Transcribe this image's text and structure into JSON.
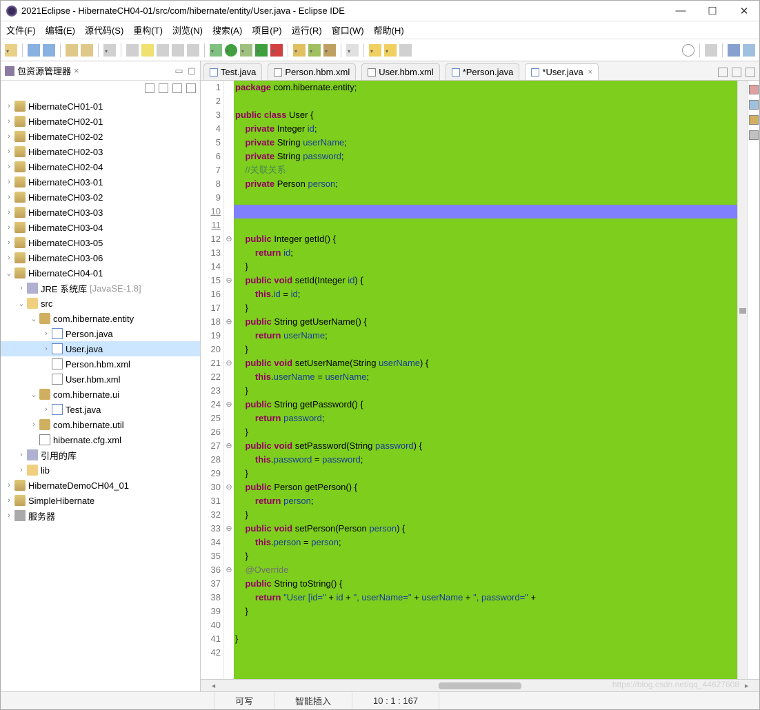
{
  "window": {
    "title": "2021Eclipse - HibernateCH04-01/src/com/hibernate/entity/User.java - Eclipse IDE"
  },
  "menu": [
    "文件(F)",
    "编辑(E)",
    "源代码(S)",
    "重构(T)",
    "浏览(N)",
    "搜索(A)",
    "项目(P)",
    "运行(R)",
    "窗口(W)",
    "帮助(H)"
  ],
  "explorer": {
    "title": "包资源管理器",
    "projects": [
      "HibernateCH01-01",
      "HibernateCH02-01",
      "HibernateCH02-02",
      "HibernateCH02-03",
      "HibernateCH02-04",
      "HibernateCH03-01",
      "HibernateCH03-02",
      "HibernateCH03-03",
      "HibernateCH03-04",
      "HibernateCH03-05",
      "HibernateCH03-06"
    ],
    "open_project": "HibernateCH04-01",
    "jre": "JRE 系统库",
    "jre_hint": "[JavaSE-1.8]",
    "src": "src",
    "pkg_entity": "com.hibernate.entity",
    "files_entity": [
      "Person.java",
      "User.java",
      "Person.hbm.xml",
      "User.hbm.xml"
    ],
    "pkg_ui": "com.hibernate.ui",
    "files_ui": [
      "Test.java"
    ],
    "pkg_util": "com.hibernate.util",
    "cfg": "hibernate.cfg.xml",
    "refs": "引用的库",
    "lib": "lib",
    "trailing": [
      "HibernateDemoCH04_01",
      "SimpleHibernate",
      "服务器"
    ]
  },
  "tabs": [
    {
      "label": "Test.java",
      "icon": "j"
    },
    {
      "label": "Person.hbm.xml",
      "icon": "x"
    },
    {
      "label": "User.hbm.xml",
      "icon": "x"
    },
    {
      "label": "*Person.java",
      "icon": "j"
    },
    {
      "label": "*User.java",
      "icon": "j",
      "active": true
    }
  ],
  "code": {
    "lines": [
      {
        "n": 1,
        "t": [
          [
            "kw",
            "package"
          ],
          [
            "type",
            " com.hibernate.entity;"
          ]
        ]
      },
      {
        "n": 2,
        "t": []
      },
      {
        "n": 3,
        "t": [
          [
            "kw",
            "public class"
          ],
          [
            "type",
            " User {"
          ]
        ]
      },
      {
        "n": 4,
        "t": [
          [
            "type",
            "    "
          ],
          [
            "kw",
            "private"
          ],
          [
            "type",
            " Integer "
          ],
          [
            "field",
            "id"
          ],
          [
            "type",
            ";"
          ]
        ]
      },
      {
        "n": 5,
        "t": [
          [
            "type",
            "    "
          ],
          [
            "kw",
            "private"
          ],
          [
            "type",
            " String "
          ],
          [
            "field",
            "userName"
          ],
          [
            "type",
            ";"
          ]
        ]
      },
      {
        "n": 6,
        "t": [
          [
            "type",
            "    "
          ],
          [
            "kw",
            "private"
          ],
          [
            "type",
            " String "
          ],
          [
            "field",
            "password"
          ],
          [
            "type",
            ";"
          ]
        ]
      },
      {
        "n": 7,
        "t": [
          [
            "type",
            "    "
          ],
          [
            "cmt",
            "//关联关系"
          ]
        ]
      },
      {
        "n": 8,
        "t": [
          [
            "type",
            "    "
          ],
          [
            "kw",
            "private"
          ],
          [
            "type",
            " Person "
          ],
          [
            "field",
            "person"
          ],
          [
            "type",
            ";"
          ]
        ]
      },
      {
        "n": 9,
        "t": []
      },
      {
        "n": 10,
        "t": [],
        "cursor": true
      },
      {
        "n": 11,
        "t": []
      },
      {
        "n": 12,
        "fold": "⊖",
        "t": [
          [
            "type",
            "    "
          ],
          [
            "kw",
            "public"
          ],
          [
            "type",
            " Integer getId() {"
          ]
        ]
      },
      {
        "n": 13,
        "t": [
          [
            "type",
            "        "
          ],
          [
            "kw",
            "return"
          ],
          [
            "type",
            " "
          ],
          [
            "field",
            "id"
          ],
          [
            "type",
            ";"
          ]
        ]
      },
      {
        "n": 14,
        "t": [
          [
            "type",
            "    }"
          ]
        ]
      },
      {
        "n": 15,
        "fold": "⊖",
        "t": [
          [
            "type",
            "    "
          ],
          [
            "kw",
            "public void"
          ],
          [
            "type",
            " setId(Integer "
          ],
          [
            "field",
            "id"
          ],
          [
            "type",
            ") {"
          ]
        ]
      },
      {
        "n": 16,
        "t": [
          [
            "type",
            "        "
          ],
          [
            "kw",
            "this"
          ],
          [
            "type",
            "."
          ],
          [
            "field",
            "id"
          ],
          [
            "type",
            " = "
          ],
          [
            "field",
            "id"
          ],
          [
            "type",
            ";"
          ]
        ]
      },
      {
        "n": 17,
        "t": [
          [
            "type",
            "    }"
          ]
        ]
      },
      {
        "n": 18,
        "fold": "⊖",
        "t": [
          [
            "type",
            "    "
          ],
          [
            "kw",
            "public"
          ],
          [
            "type",
            " String getUserName() {"
          ]
        ]
      },
      {
        "n": 19,
        "t": [
          [
            "type",
            "        "
          ],
          [
            "kw",
            "return"
          ],
          [
            "type",
            " "
          ],
          [
            "field",
            "userName"
          ],
          [
            "type",
            ";"
          ]
        ]
      },
      {
        "n": 20,
        "t": [
          [
            "type",
            "    }"
          ]
        ]
      },
      {
        "n": 21,
        "fold": "⊖",
        "t": [
          [
            "type",
            "    "
          ],
          [
            "kw",
            "public void"
          ],
          [
            "type",
            " setUserName(String "
          ],
          [
            "field",
            "userName"
          ],
          [
            "type",
            ") {"
          ]
        ]
      },
      {
        "n": 22,
        "t": [
          [
            "type",
            "        "
          ],
          [
            "kw",
            "this"
          ],
          [
            "type",
            "."
          ],
          [
            "field",
            "userName"
          ],
          [
            "type",
            " = "
          ],
          [
            "field",
            "userName"
          ],
          [
            "type",
            ";"
          ]
        ]
      },
      {
        "n": 23,
        "t": [
          [
            "type",
            "    }"
          ]
        ]
      },
      {
        "n": 24,
        "fold": "⊖",
        "t": [
          [
            "type",
            "    "
          ],
          [
            "kw",
            "public"
          ],
          [
            "type",
            " String getPassword() {"
          ]
        ]
      },
      {
        "n": 25,
        "t": [
          [
            "type",
            "        "
          ],
          [
            "kw",
            "return"
          ],
          [
            "type",
            " "
          ],
          [
            "field",
            "password"
          ],
          [
            "type",
            ";"
          ]
        ]
      },
      {
        "n": 26,
        "t": [
          [
            "type",
            "    }"
          ]
        ]
      },
      {
        "n": 27,
        "fold": "⊖",
        "t": [
          [
            "type",
            "    "
          ],
          [
            "kw",
            "public void"
          ],
          [
            "type",
            " setPassword(String "
          ],
          [
            "field",
            "password"
          ],
          [
            "type",
            ") {"
          ]
        ]
      },
      {
        "n": 28,
        "t": [
          [
            "type",
            "        "
          ],
          [
            "kw",
            "this"
          ],
          [
            "type",
            "."
          ],
          [
            "field",
            "password"
          ],
          [
            "type",
            " = "
          ],
          [
            "field",
            "password"
          ],
          [
            "type",
            ";"
          ]
        ]
      },
      {
        "n": 29,
        "t": [
          [
            "type",
            "    }"
          ]
        ]
      },
      {
        "n": 30,
        "fold": "⊖",
        "t": [
          [
            "type",
            "    "
          ],
          [
            "kw",
            "public"
          ],
          [
            "type",
            " Person getPerson() {"
          ]
        ]
      },
      {
        "n": 31,
        "t": [
          [
            "type",
            "        "
          ],
          [
            "kw",
            "return"
          ],
          [
            "type",
            " "
          ],
          [
            "field",
            "person"
          ],
          [
            "type",
            ";"
          ]
        ]
      },
      {
        "n": 32,
        "t": [
          [
            "type",
            "    }"
          ]
        ]
      },
      {
        "n": 33,
        "fold": "⊖",
        "t": [
          [
            "type",
            "    "
          ],
          [
            "kw",
            "public void"
          ],
          [
            "type",
            " setPerson(Person "
          ],
          [
            "field",
            "person"
          ],
          [
            "type",
            ") {"
          ]
        ]
      },
      {
        "n": 34,
        "t": [
          [
            "type",
            "        "
          ],
          [
            "kw",
            "this"
          ],
          [
            "type",
            "."
          ],
          [
            "field",
            "person"
          ],
          [
            "type",
            " = "
          ],
          [
            "field",
            "person"
          ],
          [
            "type",
            ";"
          ]
        ]
      },
      {
        "n": 35,
        "t": [
          [
            "type",
            "    }"
          ]
        ]
      },
      {
        "n": 36,
        "fold": "⊖",
        "t": [
          [
            "type",
            "    "
          ],
          [
            "ann",
            "@Override"
          ]
        ]
      },
      {
        "n": 37,
        "t": [
          [
            "type",
            "    "
          ],
          [
            "kw",
            "public"
          ],
          [
            "type",
            " String toString() {"
          ]
        ]
      },
      {
        "n": 38,
        "t": [
          [
            "type",
            "        "
          ],
          [
            "kw",
            "return"
          ],
          [
            "type",
            " "
          ],
          [
            "str",
            "\"User [id=\""
          ],
          [
            "type",
            " + "
          ],
          [
            "field",
            "id"
          ],
          [
            "type",
            " + "
          ],
          [
            "str",
            "\", userName=\""
          ],
          [
            "type",
            " + "
          ],
          [
            "field",
            "userName"
          ],
          [
            "type",
            " + "
          ],
          [
            "str",
            "\", password=\""
          ],
          [
            "type",
            " + "
          ]
        ]
      },
      {
        "n": 39,
        "t": [
          [
            "type",
            "    }"
          ]
        ]
      },
      {
        "n": 40,
        "t": []
      },
      {
        "n": 41,
        "t": [
          [
            "type",
            "}"
          ]
        ]
      },
      {
        "n": 42,
        "t": []
      }
    ]
  },
  "status": {
    "write": "可写",
    "insert": "智能插入",
    "pos": "10 : 1 : 167"
  },
  "watermark": "https://blog.csdn.net/qq_44627608"
}
